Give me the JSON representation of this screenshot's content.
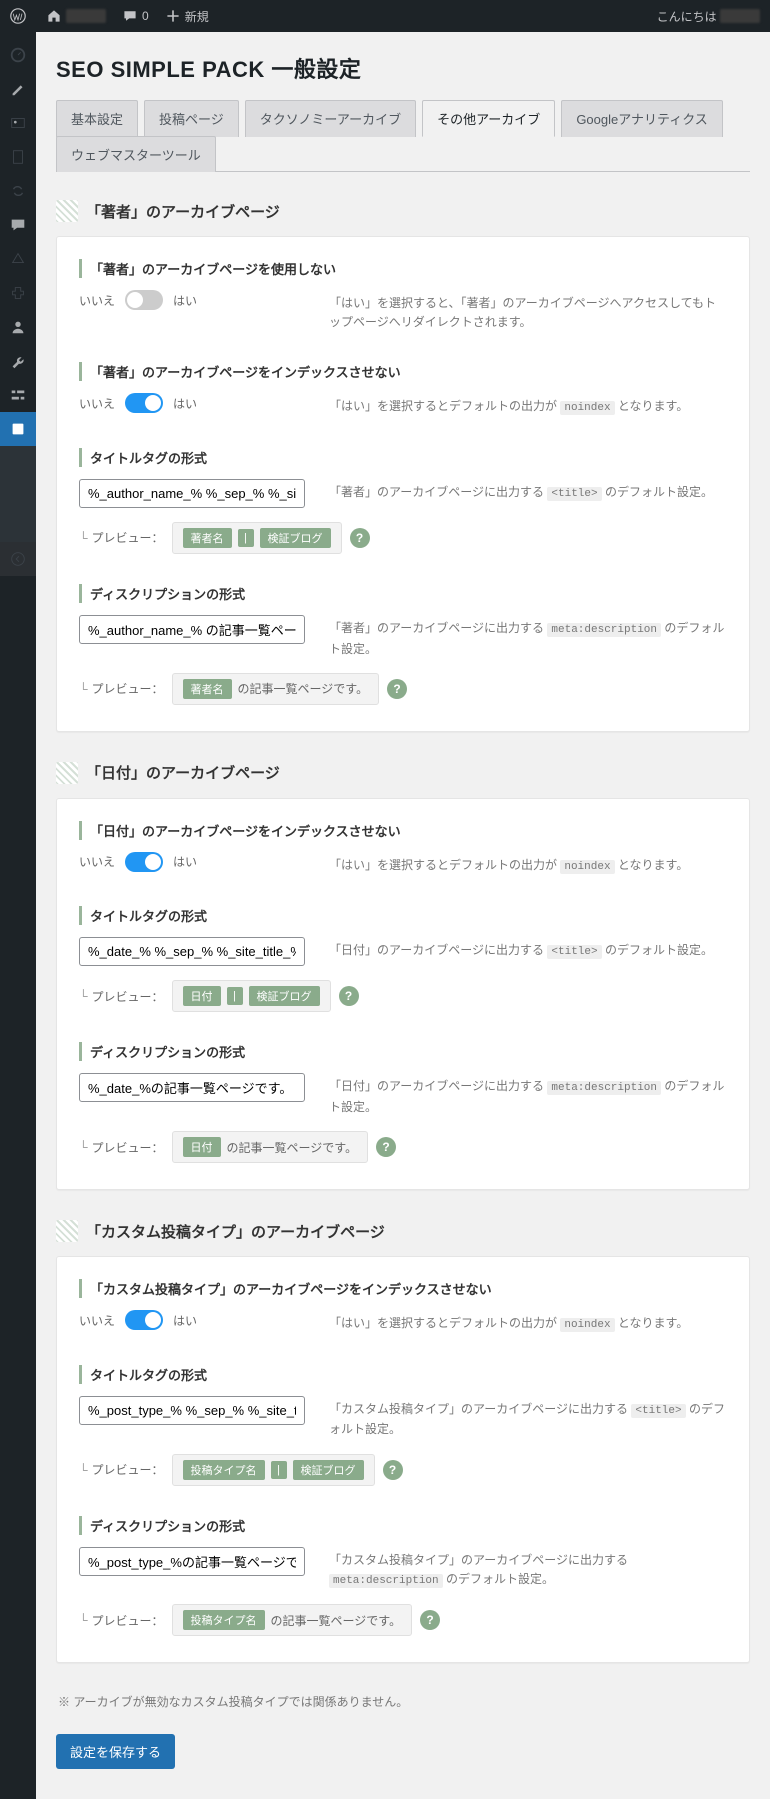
{
  "adminbar": {
    "comments": "0",
    "new": "新規",
    "greeting": "こんにちは"
  },
  "page_title": "SEO SIMPLE PACK 一般設定",
  "tabs": [
    "基本設定",
    "投稿ページ",
    "タクソノミーアーカイブ",
    "その他アーカイブ",
    "Googleアナリティクス",
    "ウェブマスターツール"
  ],
  "common": {
    "no": "いいえ",
    "yes": "はい",
    "preview": "プレビュー：",
    "help": "?"
  },
  "sections": {
    "author": {
      "heading": "「著者」のアーカイブページ",
      "disable": {
        "title": "「著者」のアーカイブページを使用しない",
        "desc_pre": "「はい」を選択すると、「著者」のアーカイブページへアクセスしてもトップページへリダイレクトされます。"
      },
      "noindex": {
        "title": "「著者」のアーカイブページをインデックスさせない",
        "desc_pre": "「はい」を選択するとデフォルトの出力が",
        "code": "noindex",
        "desc_post": " となります。"
      },
      "titletag": {
        "title": "タイトルタグの形式",
        "value": "%_author_name_% %_sep_% %_site_title_%",
        "desc_pre": "「著者」のアーカイブページに出力する ",
        "code": "<title>",
        "desc_post": " のデフォルト設定。",
        "pv": [
          "著者名",
          "|",
          "検証ブログ"
        ]
      },
      "desc": {
        "title": "ディスクリプションの形式",
        "value": "%_author_name_% の記事一覧ページです。",
        "desc_pre": "「著者」のアーカイブページに出力する ",
        "code": "meta:description",
        "desc_post": " のデフォルト設定。",
        "pv_chip": "著者名",
        "pv_text": " の記事一覧ページです。"
      }
    },
    "date": {
      "heading": "「日付」のアーカイブページ",
      "noindex": {
        "title": "「日付」のアーカイブページをインデックスさせない",
        "desc_pre": "「はい」を選択するとデフォルトの出力が",
        "code": "noindex",
        "desc_post": " となります。"
      },
      "titletag": {
        "title": "タイトルタグの形式",
        "value": "%_date_% %_sep_% %_site_title_%",
        "desc_pre": "「日付」のアーカイブページに出力する ",
        "code": "<title>",
        "desc_post": " のデフォルト設定。",
        "pv": [
          "日付",
          "|",
          "検証ブログ"
        ]
      },
      "desc": {
        "title": "ディスクリプションの形式",
        "value": "%_date_%の記事一覧ページです。",
        "desc_pre": "「日付」のアーカイブページに出力する ",
        "code": "meta:description",
        "desc_post": " のデフォルト設定。",
        "pv_chip": "日付",
        "pv_text": " の記事一覧ページです。"
      }
    },
    "cpt": {
      "heading": "「カスタム投稿タイプ」のアーカイブページ",
      "noindex": {
        "title": "「カスタム投稿タイプ」のアーカイブページをインデックスさせない",
        "desc_pre": "「はい」を選択するとデフォルトの出力が",
        "code": "noindex",
        "desc_post": " となります。"
      },
      "titletag": {
        "title": "タイトルタグの形式",
        "value": "%_post_type_% %_sep_% %_site_title_%",
        "desc_pre": "「カスタム投稿タイプ」のアーカイブページに出力する ",
        "code": "<title>",
        "desc_post": " のデフォルト設定。",
        "pv": [
          "投稿タイプ名",
          "|",
          "検証ブログ"
        ]
      },
      "desc": {
        "title": "ディスクリプションの形式",
        "value": "%_post_type_%の記事一覧ページです。",
        "desc_pre": "「カスタム投稿タイプ」のアーカイブページに出力する ",
        "code": "meta:description",
        "desc_post": " のデフォルト設定。",
        "pv_chip": "投稿タイプ名",
        "pv_text": " の記事一覧ページです。"
      }
    }
  },
  "footnote": "※ アーカイブが無効なカスタム投稿タイプでは関係ありません。",
  "save": "設定を保存する"
}
